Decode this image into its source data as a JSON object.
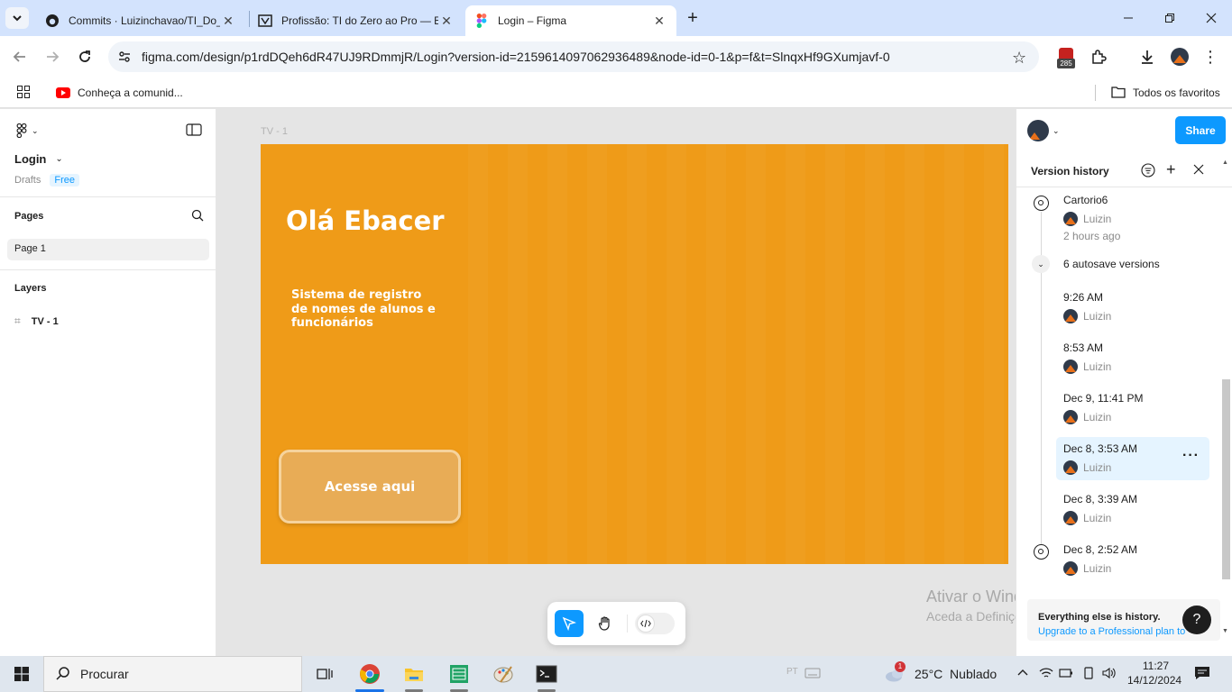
{
  "browser": {
    "tabs": [
      {
        "title": "Commits · Luizinchavao/TI_Do_Zero"
      },
      {
        "title": "Profissão: TI do Zero ao Pro — EBAC"
      },
      {
        "title": "Login – Figma"
      }
    ],
    "url": "figma.com/design/p1rdDQeh6dR47UJ9RDmmjR/Login?version-id=2159614097062936489&node-id=0-1&p=f&t=SlnqxHf9GXumjavf-0",
    "extension_badge": "285",
    "bookmark": "Conheça a comunid...",
    "all_favorites": "Todos os favoritos"
  },
  "figma": {
    "file_name": "Login",
    "location": "Drafts",
    "plan": "Free",
    "pages_header": "Pages",
    "pages": [
      "Page 1"
    ],
    "layers_header": "Layers",
    "layers": [
      "TV - 1"
    ],
    "frame_label": "TV - 1",
    "frame": {
      "heading": "Olá Ebacer",
      "subtitle_lines": [
        "Sistema de registro",
        "de nomes de alunos e",
        "funcionários"
      ],
      "button": "Acesse aqui"
    },
    "share": "Share",
    "version_history": {
      "title": "Version history",
      "top_version": {
        "name": "Cartorio6",
        "user": "Luizin",
        "time": "2 hours ago"
      },
      "autosave_label": "6 autosave versions",
      "autosaves": [
        {
          "time": "9:26 AM",
          "user": "Luizin"
        },
        {
          "time": "8:53 AM",
          "user": "Luizin"
        },
        {
          "time": "Dec 9, 11:41 PM",
          "user": "Luizin"
        },
        {
          "time": "Dec 8, 3:53 AM",
          "user": "Luizin",
          "selected": true
        },
        {
          "time": "Dec 8, 3:39 AM",
          "user": "Luizin"
        }
      ],
      "last_version": {
        "time": "Dec 8, 2:52 AM",
        "user": "Luizin"
      },
      "footer_title": "Everything else is history.",
      "footer_link": "Upgrade to a Professional plan to"
    }
  },
  "watermark": {
    "line1": "Ativar o Windows",
    "line2": "Aceda a Definições para ativar o Windows."
  },
  "taskbar": {
    "search": "Procurar",
    "weather": "25°C  Nublado",
    "notif_count": "1",
    "time": "11:27",
    "date": "14/12/2024"
  },
  "colors": {
    "frame_bg": "#ef9b18",
    "button_bg": "#e8ac56",
    "share_bg": "#0d99ff"
  }
}
